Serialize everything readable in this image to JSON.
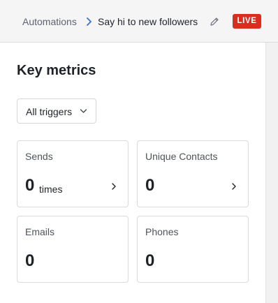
{
  "header": {
    "breadcrumb_root": "Automations",
    "breadcrumb_separator_icon": "chevron-right-icon",
    "automation_name": "Say hi to new followers",
    "edit_icon": "pencil-icon",
    "status_badge": "LIVE",
    "status_color": "#d92d20"
  },
  "metrics": {
    "title": "Key metrics",
    "filter": {
      "selected": "All triggers",
      "icon": "chevron-down-icon"
    },
    "cards": [
      {
        "title": "Sends",
        "value": "0",
        "unit": "times",
        "arrow_icon": "chevron-right-icon"
      },
      {
        "title": "Unique Contacts",
        "value": "0",
        "arrow_icon": "chevron-right-icon"
      },
      {
        "title": "Emails",
        "value": "0"
      },
      {
        "title": "Phones",
        "value": "0"
      }
    ]
  }
}
